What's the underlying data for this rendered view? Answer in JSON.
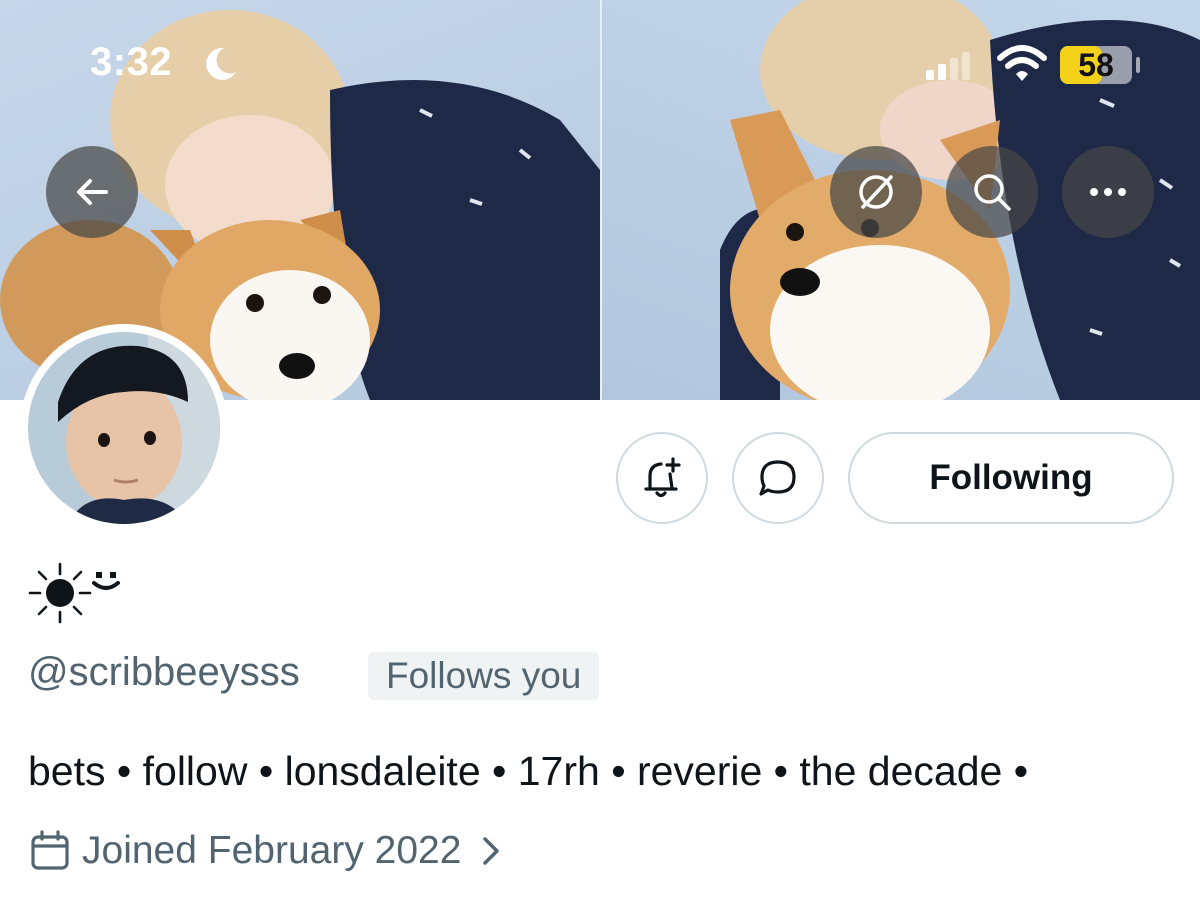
{
  "status_bar": {
    "time": "3:32",
    "battery": "58",
    "battery_level": 0.58,
    "moon_icon": "moon-icon",
    "signal_icon": "signal-icon",
    "wifi_icon": "wifi-icon"
  },
  "header": {
    "back_icon": "arrow-left-icon",
    "mute_icon": "no-notifications-icon",
    "search_icon": "search-icon",
    "more_icon": "more-horizontal-icon"
  },
  "profile": {
    "name_icon": "sun-and-smile-emoji",
    "handle": "@scribbeeysss",
    "follows_you": "Follows you",
    "bio": "bets • follow • lonsdaleite • 17rh • reverie • the decade •",
    "joined": "Joined February 2022"
  },
  "actions": {
    "notify_icon": "bell-plus-icon",
    "message_icon": "message-bubble-icon",
    "following_label": "Following"
  },
  "colors": {
    "text_primary": "#0f1419",
    "text_secondary": "#536471",
    "border": "#cfd9de",
    "battery_yellow": "#f5d21a"
  }
}
